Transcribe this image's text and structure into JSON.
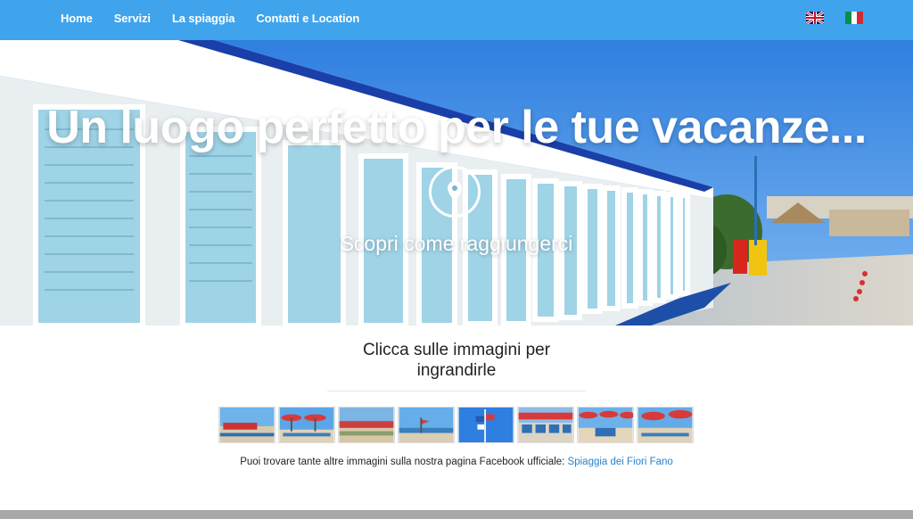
{
  "nav": {
    "items": [
      {
        "label": "Home"
      },
      {
        "label": "Servizi"
      },
      {
        "label": "La spiaggia"
      },
      {
        "label": "Contatti e Location"
      }
    ],
    "flags": [
      "uk-flag-icon",
      "italy-flag-icon"
    ]
  },
  "hero": {
    "title": "Un luogo perfetto per le tue vacanze...",
    "link": "Scopri come raggiungerci",
    "icon": "map-pin-icon"
  },
  "gallery": {
    "title": "Clicca sulle immagini per ingrandirle",
    "thumb_count": 8
  },
  "facebook": {
    "text": "Puoi trovare tante altre immagini sulla nostra pagina Facebook ufficiale: ",
    "link": "Spiaggia dei Fiori Fano"
  },
  "colors": {
    "navbar": "#3fa4ec",
    "link": "#2a82c9",
    "footer": "#a8a8a8"
  }
}
